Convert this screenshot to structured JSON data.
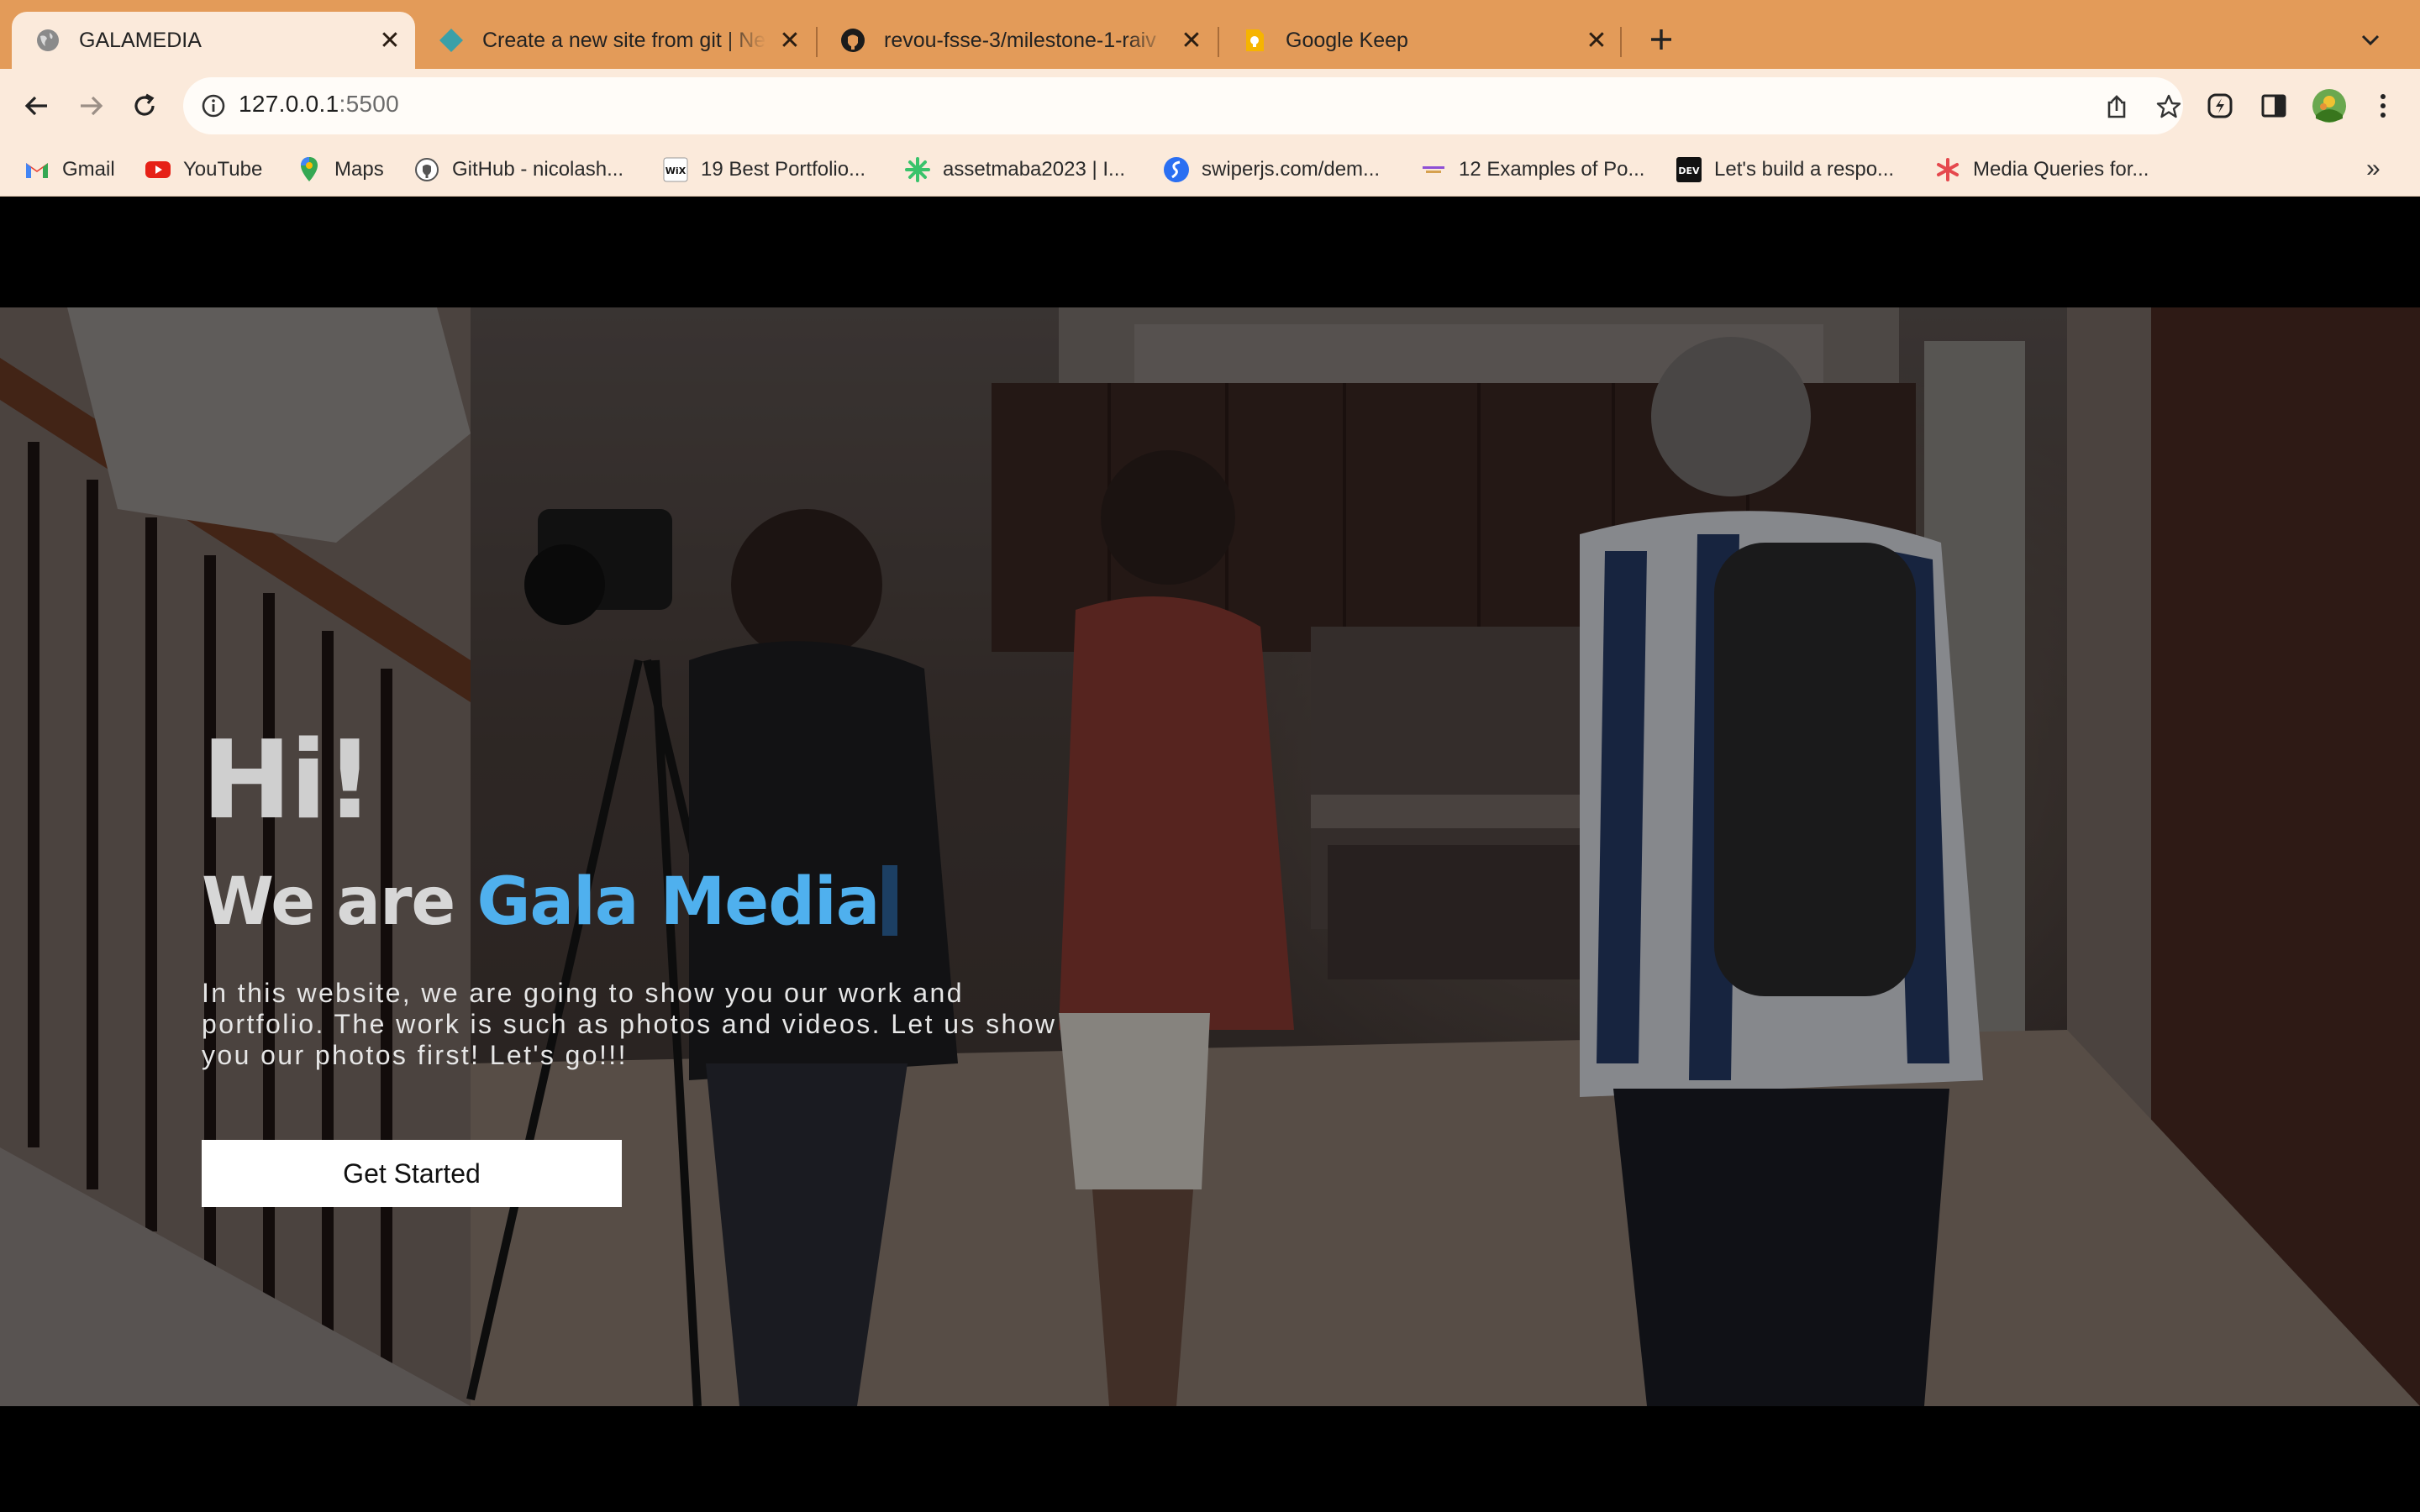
{
  "browser": {
    "tabs": [
      {
        "title": "GALAMEDIA",
        "active": true,
        "icon": "globe-icon"
      },
      {
        "title": "Create a new site from git | Netlify",
        "active": false,
        "icon": "netlify-icon"
      },
      {
        "title": "revou-fsse-3/milestone-1-raiv",
        "active": false,
        "icon": "github-icon"
      },
      {
        "title": "Google Keep",
        "active": false,
        "icon": "google-keep-icon"
      }
    ],
    "url_host": "127.0.0.1",
    "url_port": ":5500",
    "bookmarks": [
      {
        "label": "Gmail",
        "icon": "gmail-icon"
      },
      {
        "label": "YouTube",
        "icon": "youtube-icon"
      },
      {
        "label": "Maps",
        "icon": "maps-icon"
      },
      {
        "label": "GitHub - nicolash...",
        "icon": "github-icon"
      },
      {
        "label": "19 Best Portfolio...",
        "icon": "wix-icon"
      },
      {
        "label": "assetmaba2023 | I...",
        "icon": "asterisk-icon"
      },
      {
        "label": "swiperjs.com/dem...",
        "icon": "swiper-icon"
      },
      {
        "label": "12 Examples of Po...",
        "icon": "site-icon"
      },
      {
        "label": "Let's build a respo...",
        "icon": "dev-icon"
      },
      {
        "label": "Media Queries for...",
        "icon": "asterisk-red-icon"
      }
    ],
    "bookmarks_more": "»"
  },
  "hero": {
    "greeting": "Hi!",
    "headline_prefix": "We are ",
    "headline_brand": "Gala Media",
    "description": "In this website, we are going to show you our work and portfolio. The work is such as photos and videos. Let us show you our photos first! Let's go!!!",
    "cta_label": "Get Started"
  },
  "colors": {
    "tabstrip": "#e39b59",
    "toolbar": "#fbeadb",
    "brand_accent": "#4fb0ee",
    "page_bg": "#000000"
  }
}
